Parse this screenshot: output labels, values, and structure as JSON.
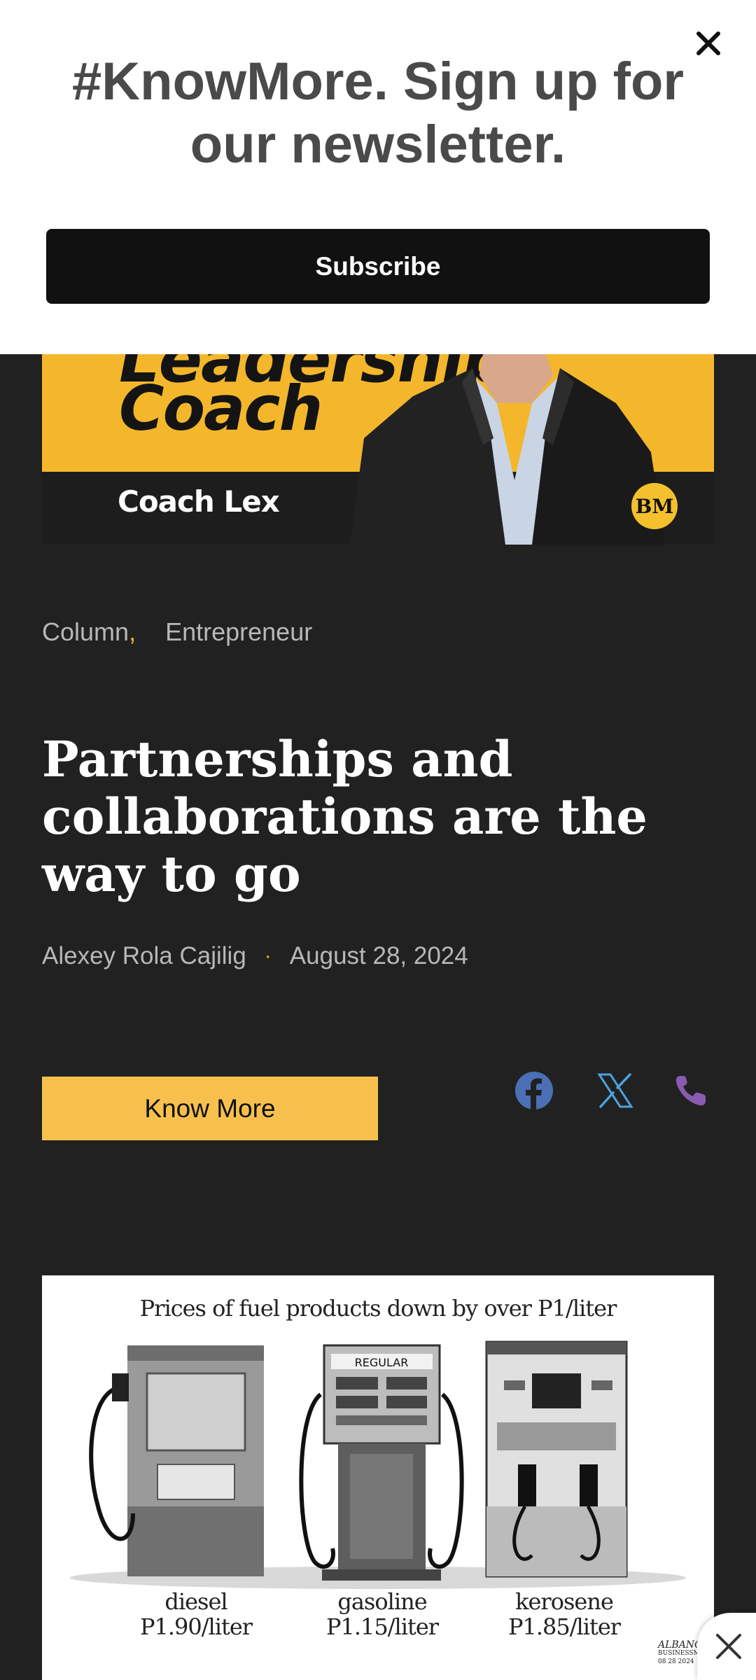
{
  "newsletter": {
    "title": "#KnowMore. Sign up for our newsletter.",
    "subscribe_label": "Subscribe"
  },
  "hero": {
    "heading_partial": "Leadership",
    "heading": "Coach",
    "name": "Coach Lex",
    "badge": "BM"
  },
  "article": {
    "categories": [
      "Column",
      "Entrepreneur"
    ],
    "category_separator": ",",
    "title": "Partnerships and collaborations are the way to go",
    "author": "Alexey Rola Cajilig",
    "meta_dot": "·",
    "date": "August 28, 2024",
    "know_more_label": "Know More"
  },
  "share": {
    "icons": [
      "facebook-icon",
      "x-icon",
      "phone-icon"
    ],
    "colors": {
      "facebook": "#4a6fb5",
      "x": "#4aa3df",
      "phone": "#8a5bb0"
    }
  },
  "fuel_image": {
    "title": "Prices of fuel products down by over P1/liter",
    "pumps": [
      {
        "fuel": "diesel",
        "price": "P1.90/liter"
      },
      {
        "fuel": "gasoline",
        "price": "P1.15/liter"
      },
      {
        "fuel": "kerosene",
        "price": "P1.85/liter"
      }
    ],
    "regular_label": "REGULAR",
    "signature": "ALBANO",
    "signature_sub": "BUSINESSMIRROR",
    "signature_date": "08 28 2024"
  },
  "colors": {
    "background": "#212121",
    "accent": "#f7c04d",
    "hero_yellow": "#f4b72b"
  }
}
